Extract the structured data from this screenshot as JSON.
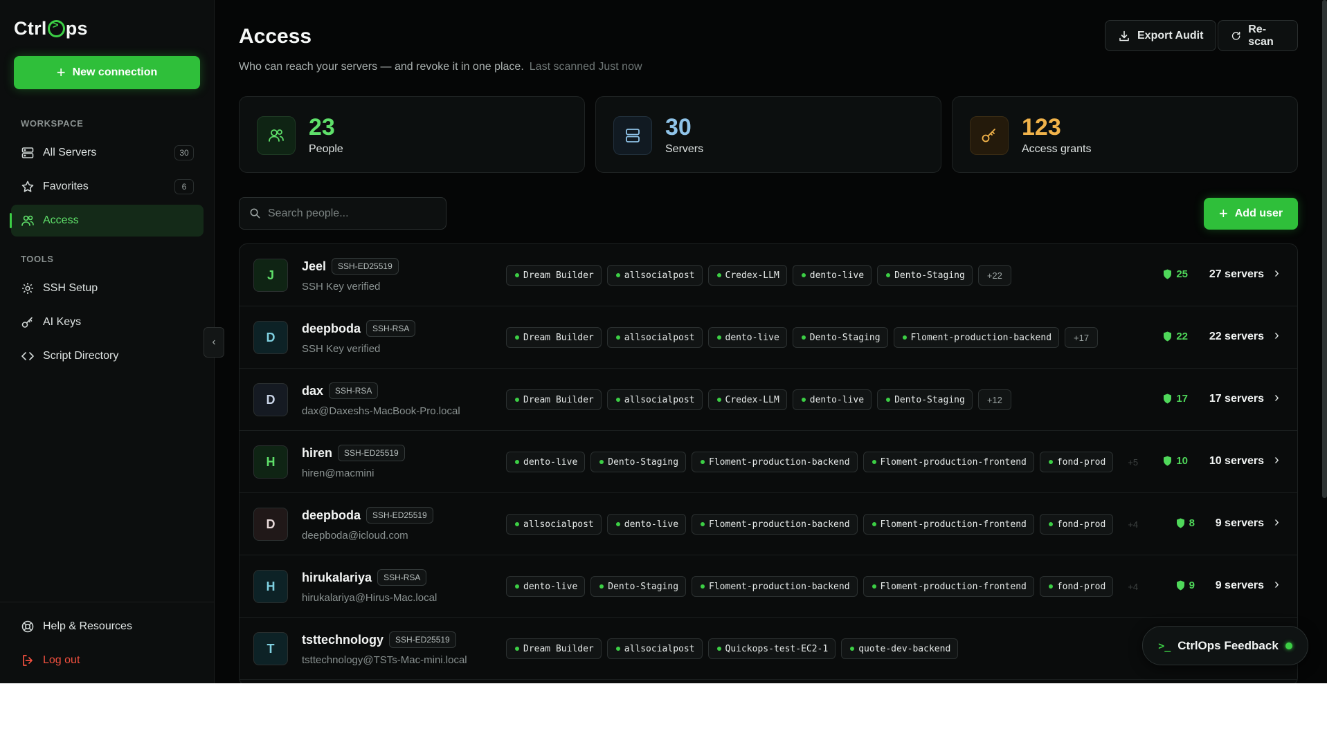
{
  "brand": {
    "logo_left": "Ctrl",
    "logo_right": "ps"
  },
  "sidebar": {
    "new_connection": "New connection",
    "workspace_label": "WORKSPACE",
    "tools_label": "TOOLS",
    "workspace_items": [
      {
        "label": "All Servers",
        "count": "30",
        "icon": "server-icon"
      },
      {
        "label": "Favorites",
        "count": "6",
        "icon": "star-icon"
      },
      {
        "label": "Access",
        "count": "",
        "icon": "users-icon",
        "active": true
      }
    ],
    "tool_items": [
      {
        "label": "SSH Setup",
        "icon": "gear-icon"
      },
      {
        "label": "AI Keys",
        "icon": "key-icon"
      },
      {
        "label": "Script Directory",
        "icon": "code-icon"
      }
    ],
    "help": "Help & Resources",
    "logout": "Log out",
    "collapse_glyph": "‹"
  },
  "header": {
    "title": "Access",
    "subtitle": "Who can reach your servers — and revoke it in one place.",
    "last_scanned": "Last scanned Just now",
    "export_label": "Export Audit",
    "rescan_label": "Re-scan"
  },
  "stats": [
    {
      "value": "23",
      "label": "People",
      "color": "#5fe06a",
      "icon": "people-icon"
    },
    {
      "value": "30",
      "label": "Servers",
      "color": "#8fc3e8",
      "icon": "server-stack-icon"
    },
    {
      "value": "123",
      "label": "Access grants",
      "color": "#f0b24a",
      "icon": "key-icon"
    }
  ],
  "search": {
    "placeholder": "Search people..."
  },
  "add_user_label": "Add user",
  "people": [
    {
      "initial": "J",
      "name": "Jeel",
      "key": "SSH-ED25519",
      "sub": "SSH Key verified",
      "tags": [
        "Dream Builder",
        "allsocialpost",
        "Credex-LLM",
        "dento-live",
        "Dento-Staging"
      ],
      "more": "+22",
      "more_fade": false,
      "grants": "25",
      "servers": "27 servers",
      "color": "#5fe06a",
      "bg": "#0f2414"
    },
    {
      "initial": "D",
      "name": "deepboda",
      "key": "SSH-RSA",
      "sub": "SSH Key verified",
      "tags": [
        "Dream Builder",
        "allsocialpost",
        "dento-live",
        "Dento-Staging",
        "Floment-production-backend"
      ],
      "more": "+17",
      "more_fade": false,
      "grants": "22",
      "servers": "22 servers",
      "color": "#7fd0e0",
      "bg": "#0d2226"
    },
    {
      "initial": "D",
      "name": "dax",
      "key": "SSH-RSA",
      "sub": "dax@Daxeshs-MacBook-Pro.local",
      "tags": [
        "Dream Builder",
        "allsocialpost",
        "Credex-LLM",
        "dento-live",
        "Dento-Staging"
      ],
      "more": "+12",
      "more_fade": false,
      "grants": "17",
      "servers": "17 servers",
      "color": "#c9d4e6",
      "bg": "#151a22"
    },
    {
      "initial": "H",
      "name": "hiren",
      "key": "SSH-ED25519",
      "sub": "hiren@macmini",
      "tags": [
        "dento-live",
        "Dento-Staging",
        "Floment-production-backend",
        "Floment-production-frontend",
        "fond-prod"
      ],
      "more": "+5",
      "more_fade": true,
      "grants": "10",
      "servers": "10 servers",
      "color": "#5fe06a",
      "bg": "#0f2414"
    },
    {
      "initial": "D",
      "name": "deepboda",
      "key": "SSH-ED25519",
      "sub": "deepboda@icloud.com",
      "tags": [
        "allsocialpost",
        "dento-live",
        "Floment-production-backend",
        "Floment-production-frontend",
        "fond-prod"
      ],
      "more": "+4",
      "more_fade": true,
      "grants": "8",
      "servers": "9 servers",
      "color": "#e7d9d9",
      "bg": "#201818"
    },
    {
      "initial": "H",
      "name": "hirukalariya",
      "key": "SSH-RSA",
      "sub": "hirukalariya@Hirus-Mac.local",
      "tags": [
        "dento-live",
        "Dento-Staging",
        "Floment-production-backend",
        "Floment-production-frontend",
        "fond-prod"
      ],
      "more": "+4",
      "more_fade": true,
      "grants": "9",
      "servers": "9 servers",
      "color": "#7fd0e0",
      "bg": "#0d2226"
    },
    {
      "initial": "T",
      "name": "tsttechnology",
      "key": "SSH-ED25519",
      "sub": "tsttechnology@TSTs-Mac-mini.local",
      "tags": [
        "Dream Builder",
        "allsocialpost",
        "Quickops-test-EC2-1",
        "quote-dev-backend"
      ],
      "more": "",
      "more_fade": false,
      "grants": "",
      "servers": "",
      "color": "#7fd0e0",
      "bg": "#0d2226"
    }
  ],
  "feedback": {
    "prompt": ">_",
    "label": "CtrlOps Feedback"
  }
}
